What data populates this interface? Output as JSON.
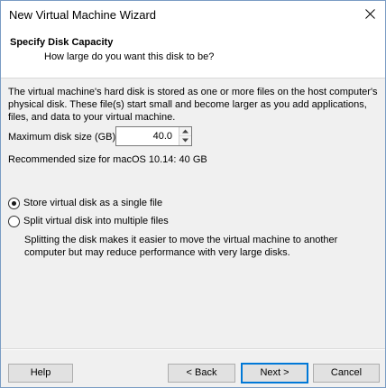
{
  "window": {
    "title": "New Virtual Machine Wizard",
    "close_icon": "close-icon"
  },
  "header": {
    "title": "Specify Disk Capacity",
    "subtitle": "How large do you want this disk to be?"
  },
  "content": {
    "description": "The virtual machine's hard disk is stored as one or more files on the host computer's physical disk. These file(s) start small and become larger as you add applications, files, and data to your virtual machine.",
    "max_disk_label": "Maximum disk size (GB):",
    "max_disk_value": "40.0",
    "recommended": "Recommended size for macOS 10.14: 40 GB",
    "options": [
      {
        "label": "Store virtual disk as a single file",
        "selected": true
      },
      {
        "label": "Split virtual disk into multiple files",
        "selected": false
      }
    ],
    "split_description": "Splitting the disk makes it easier to move the virtual machine to another computer but may reduce performance with very large disks."
  },
  "footer": {
    "help_label": "Help",
    "back_label": "< Back",
    "next_label": "Next >",
    "cancel_label": "Cancel"
  },
  "colors": {
    "accent": "#0078d7",
    "dialog_bg": "#f0f0f0",
    "header_bg": "#ffffff"
  }
}
